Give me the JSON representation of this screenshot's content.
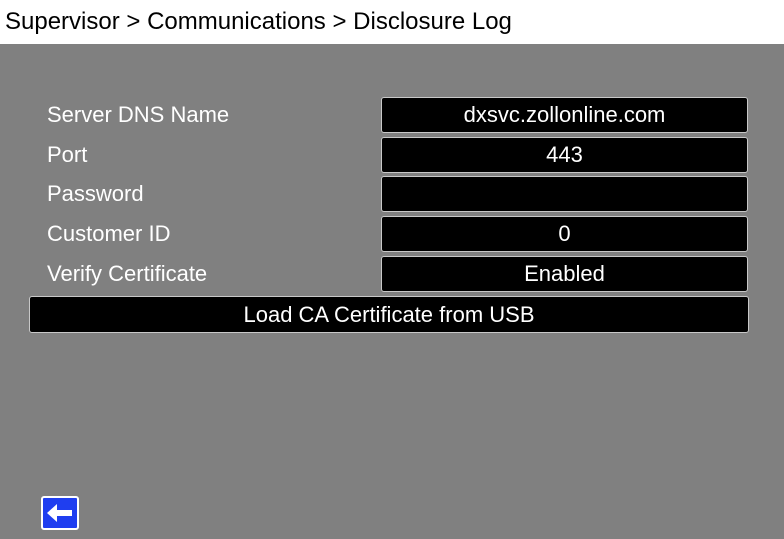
{
  "header": {
    "breadcrumb": "Supervisor > Communications > Disclosure Log"
  },
  "settings": [
    {
      "label": "Server DNS Name",
      "value": "dxsvc.zollonline.com"
    },
    {
      "label": "Port",
      "value": "443"
    },
    {
      "label": "Password",
      "value": ""
    },
    {
      "label": "Customer ID",
      "value": "0"
    },
    {
      "label": "Verify Certificate",
      "value": "Enabled"
    }
  ],
  "actions": {
    "load_cert_label": "Load CA Certificate from USB",
    "back_icon": "back-arrow-icon"
  },
  "colors": {
    "background": "#808080",
    "field": "#000000",
    "accent": "#1f3ef0"
  }
}
